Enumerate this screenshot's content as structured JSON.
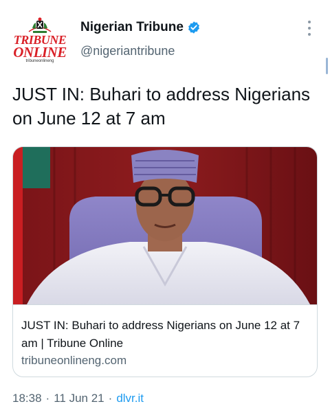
{
  "account": {
    "display_name": "Nigerian Tribune",
    "handle": "@nigeriantribune",
    "logo_line1": "TRIBUNE",
    "logo_line2": "ONLINE",
    "logo_url": "tribuneonlineng",
    "verified_icon": "verified-badge-icon",
    "accent_color": "#1d9bf0",
    "logo_color": "#d92027"
  },
  "tweet": {
    "text": "JUST IN: Buhari to address Nigerians on June 12 at 7 am"
  },
  "card": {
    "title": "JUST IN: Buhari to address Nigerians on June 12 at 7 am | Tribune Online",
    "domain": "tribuneonlineng.com"
  },
  "meta": {
    "time": "18:38",
    "separator": "·",
    "date": "11 Jun 21",
    "source": "dlvr.it"
  }
}
